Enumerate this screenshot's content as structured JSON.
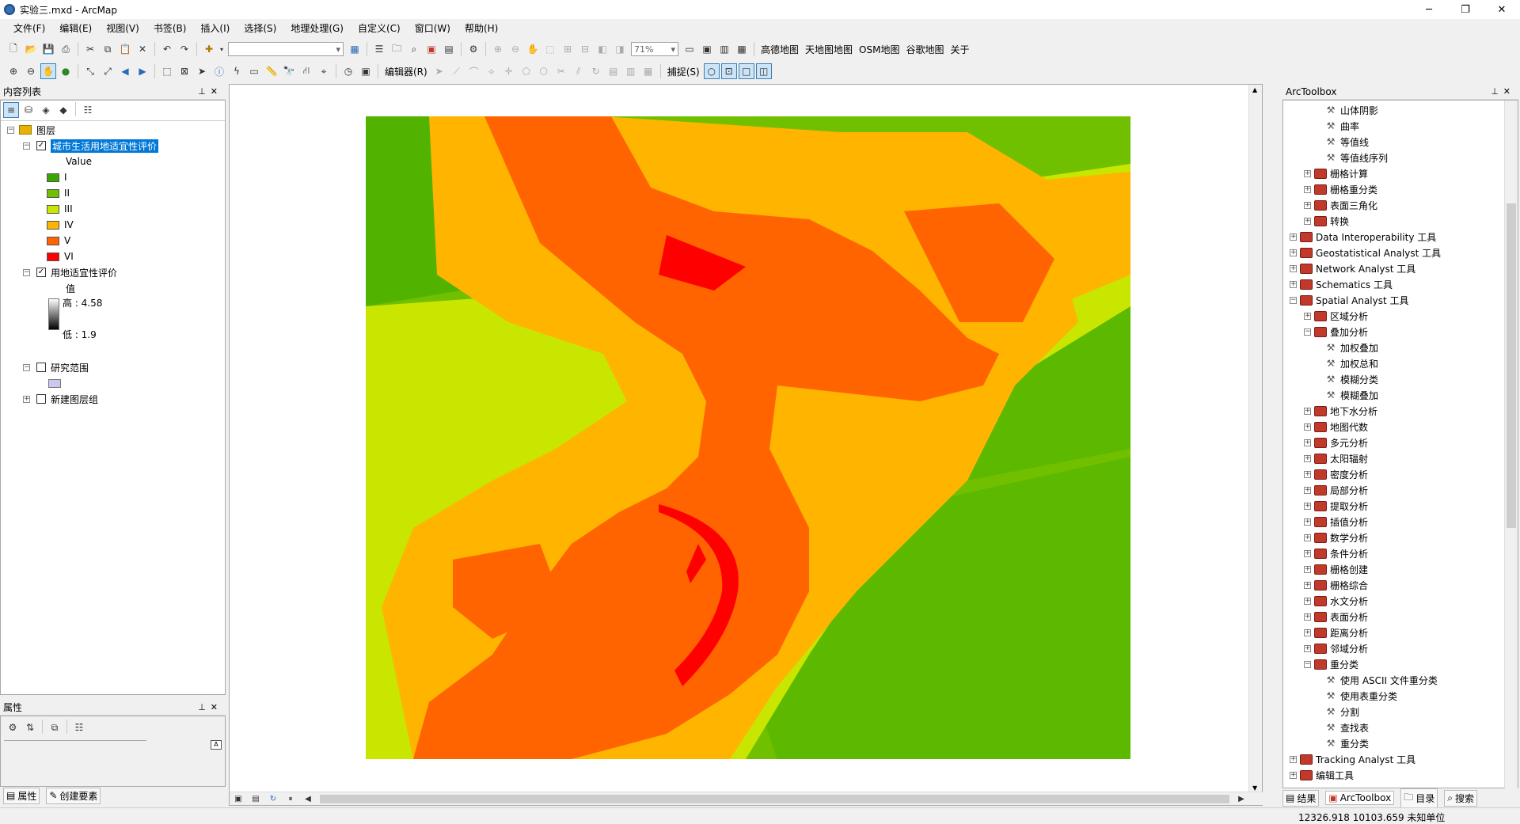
{
  "window": {
    "title": "实验三.mxd - ArcMap",
    "minimize": "─",
    "maximize": "❐",
    "close": "✕"
  },
  "menu": [
    "文件(F)",
    "编辑(E)",
    "视图(V)",
    "书签(B)",
    "插入(I)",
    "选择(S)",
    "地理处理(G)",
    "自定义(C)",
    "窗口(W)",
    "帮助(H)"
  ],
  "toolbar": {
    "scale_value": "",
    "zoom_value": "71%",
    "basemaps": [
      "高德地图",
      "天地图地图",
      "OSM地图",
      "谷歌地图",
      "关于"
    ],
    "editor_label": "编辑器(R)",
    "snapping_label": "捕捉(S)"
  },
  "toc": {
    "title": "内容列表",
    "root": "图层",
    "layer1": {
      "name": "城市生活用地适宜性评价",
      "field": "Value",
      "classes": [
        {
          "label": "I",
          "color": "#38a800"
        },
        {
          "label": "II",
          "color": "#70c000"
        },
        {
          "label": "III",
          "color": "#c8e600"
        },
        {
          "label": "IV",
          "color": "#ffb400"
        },
        {
          "label": "V",
          "color": "#ff6400"
        },
        {
          "label": "VI",
          "color": "#ff0000"
        }
      ]
    },
    "layer2": {
      "name": "用地适宜性评价",
      "field": "值",
      "high": "高 : 4.58",
      "low": "低 : 1.9"
    },
    "layer3": {
      "name": "研究范围"
    },
    "layer4": {
      "name": "新建图层组"
    }
  },
  "properties": {
    "title": "属性",
    "tab1": "属性",
    "tab2": "创建要素"
  },
  "toolbox": {
    "title": "ArcToolbox",
    "items": [
      {
        "label": "山体阴影",
        "kind": "tool",
        "level": 3
      },
      {
        "label": "曲率",
        "kind": "tool",
        "level": 3
      },
      {
        "label": "等值线",
        "kind": "tool",
        "level": 3
      },
      {
        "label": "等值线序列",
        "kind": "tool",
        "level": 3
      },
      {
        "label": "栅格计算",
        "kind": "set",
        "level": 2,
        "exp": "+"
      },
      {
        "label": "栅格重分类",
        "kind": "set",
        "level": 2,
        "exp": "+"
      },
      {
        "label": "表面三角化",
        "kind": "set",
        "level": 2,
        "exp": "+"
      },
      {
        "label": "转换",
        "kind": "set",
        "level": 2,
        "exp": "+"
      },
      {
        "label": "Data Interoperability 工具",
        "kind": "box",
        "level": 1,
        "exp": "+"
      },
      {
        "label": "Geostatistical Analyst 工具",
        "kind": "box",
        "level": 1,
        "exp": "+"
      },
      {
        "label": "Network Analyst 工具",
        "kind": "box",
        "level": 1,
        "exp": "+"
      },
      {
        "label": "Schematics 工具",
        "kind": "box",
        "level": 1,
        "exp": "+"
      },
      {
        "label": "Spatial Analyst 工具",
        "kind": "box",
        "level": 1,
        "exp": "−"
      },
      {
        "label": "区域分析",
        "kind": "set",
        "level": 2,
        "exp": "+"
      },
      {
        "label": "叠加分析",
        "kind": "set",
        "level": 2,
        "exp": "−"
      },
      {
        "label": "加权叠加",
        "kind": "tool",
        "level": 3
      },
      {
        "label": "加权总和",
        "kind": "tool",
        "level": 3
      },
      {
        "label": "模糊分类",
        "kind": "tool",
        "level": 3
      },
      {
        "label": "模糊叠加",
        "kind": "tool",
        "level": 3
      },
      {
        "label": "地下水分析",
        "kind": "set",
        "level": 2,
        "exp": "+"
      },
      {
        "label": "地图代数",
        "kind": "set",
        "level": 2,
        "exp": "+"
      },
      {
        "label": "多元分析",
        "kind": "set",
        "level": 2,
        "exp": "+"
      },
      {
        "label": "太阳辐射",
        "kind": "set",
        "level": 2,
        "exp": "+"
      },
      {
        "label": "密度分析",
        "kind": "set",
        "level": 2,
        "exp": "+"
      },
      {
        "label": "局部分析",
        "kind": "set",
        "level": 2,
        "exp": "+"
      },
      {
        "label": "提取分析",
        "kind": "set",
        "level": 2,
        "exp": "+"
      },
      {
        "label": "插值分析",
        "kind": "set",
        "level": 2,
        "exp": "+"
      },
      {
        "label": "数学分析",
        "kind": "set",
        "level": 2,
        "exp": "+"
      },
      {
        "label": "条件分析",
        "kind": "set",
        "level": 2,
        "exp": "+"
      },
      {
        "label": "栅格创建",
        "kind": "set",
        "level": 2,
        "exp": "+"
      },
      {
        "label": "栅格综合",
        "kind": "set",
        "level": 2,
        "exp": "+"
      },
      {
        "label": "水文分析",
        "kind": "set",
        "level": 2,
        "exp": "+"
      },
      {
        "label": "表面分析",
        "kind": "set",
        "level": 2,
        "exp": "+"
      },
      {
        "label": "距离分析",
        "kind": "set",
        "level": 2,
        "exp": "+"
      },
      {
        "label": "邻域分析",
        "kind": "set",
        "level": 2,
        "exp": "+"
      },
      {
        "label": "重分类",
        "kind": "set",
        "level": 2,
        "exp": "−"
      },
      {
        "label": "使用 ASCII 文件重分类",
        "kind": "tool",
        "level": 3
      },
      {
        "label": "使用表重分类",
        "kind": "tool",
        "level": 3
      },
      {
        "label": "分割",
        "kind": "tool",
        "level": 3
      },
      {
        "label": "查找表",
        "kind": "tool",
        "level": 3
      },
      {
        "label": "重分类",
        "kind": "tool",
        "level": 3
      },
      {
        "label": "Tracking Analyst 工具",
        "kind": "box",
        "level": 1,
        "exp": "+"
      },
      {
        "label": "编辑工具",
        "kind": "box",
        "level": 1,
        "exp": "+"
      }
    ],
    "tabs": [
      "结果",
      "ArcToolbox",
      "目录",
      "搜索"
    ]
  },
  "status": {
    "coords": "12326.918   10103.659 未知单位"
  }
}
